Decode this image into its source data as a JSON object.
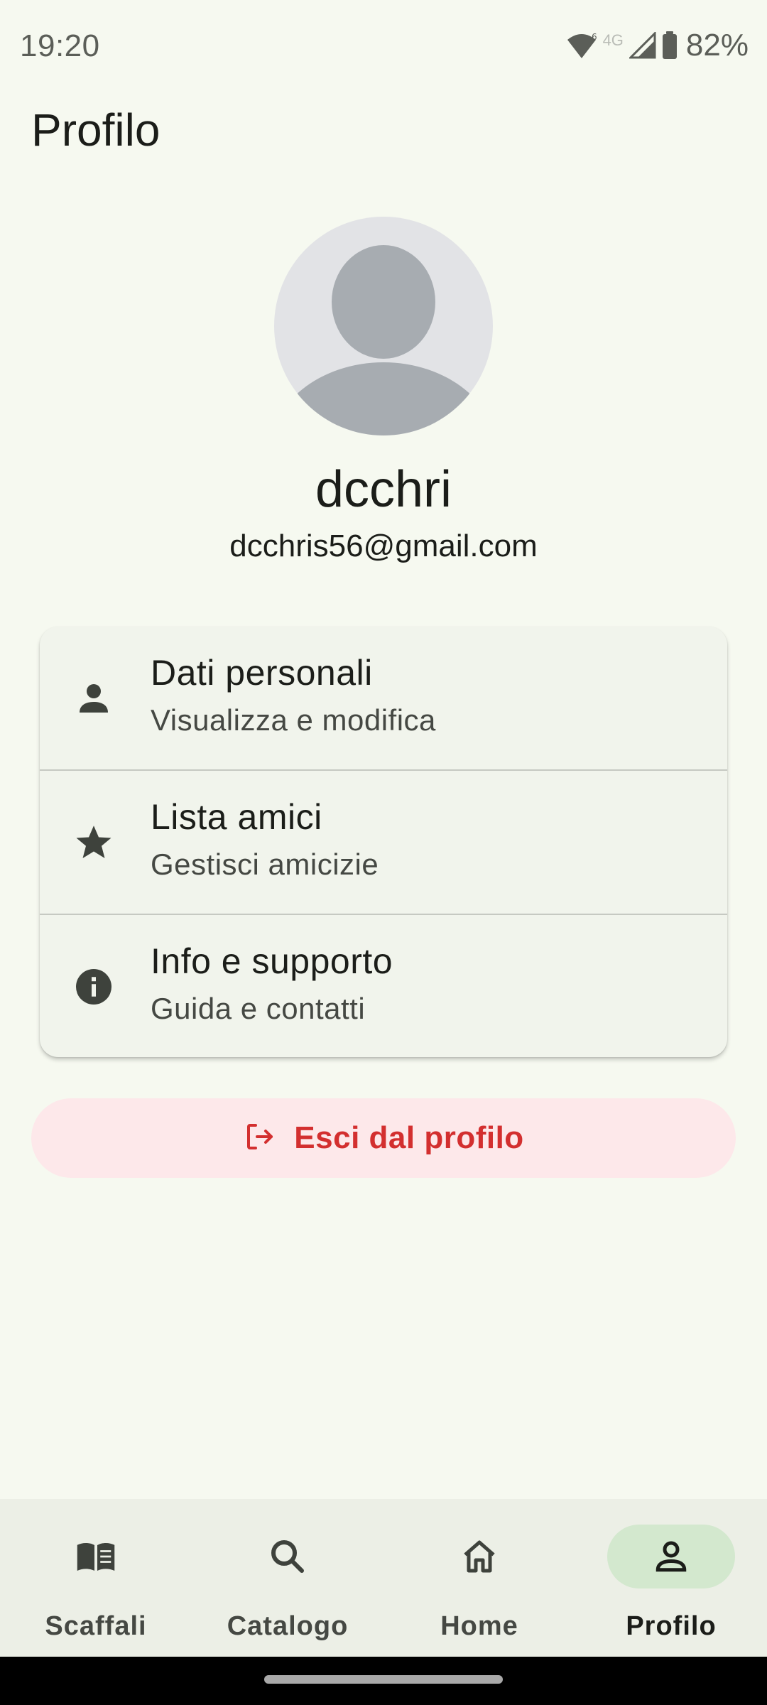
{
  "status_bar": {
    "time": "19:20",
    "network": "4G",
    "battery": "82%",
    "icons": [
      "wifi-icon",
      "cell-signal-icon",
      "battery-icon"
    ]
  },
  "header": {
    "title": "Profilo"
  },
  "profile": {
    "username": "dcchri",
    "email": "dcchris56@gmail.com",
    "avatar_icon": "default-avatar-icon"
  },
  "menu": {
    "items": [
      {
        "icon": "person-icon",
        "title": "Dati personali",
        "subtitle": "Visualizza e modifica"
      },
      {
        "icon": "star-icon",
        "title": "Lista amici",
        "subtitle": "Gestisci amicizie"
      },
      {
        "icon": "info-icon",
        "title": "Info e supporto",
        "subtitle": "Guida e contatti"
      }
    ]
  },
  "logout": {
    "label": "Esci dal profilo",
    "icon": "logout-icon"
  },
  "bottom_nav": {
    "items": [
      {
        "label": "Scaffali",
        "icon": "book-icon",
        "active": false
      },
      {
        "label": "Catalogo",
        "icon": "search-icon",
        "active": false
      },
      {
        "label": "Home",
        "icon": "home-icon",
        "active": false
      },
      {
        "label": "Profilo",
        "icon": "person-outline-icon",
        "active": true
      }
    ]
  },
  "colors": {
    "background": "#f6f9f0",
    "card": "#f1f4ec",
    "logout_bg": "#fde8ea",
    "logout_text": "#d32f2f",
    "nav_active_pill": "#d3e8ce"
  }
}
